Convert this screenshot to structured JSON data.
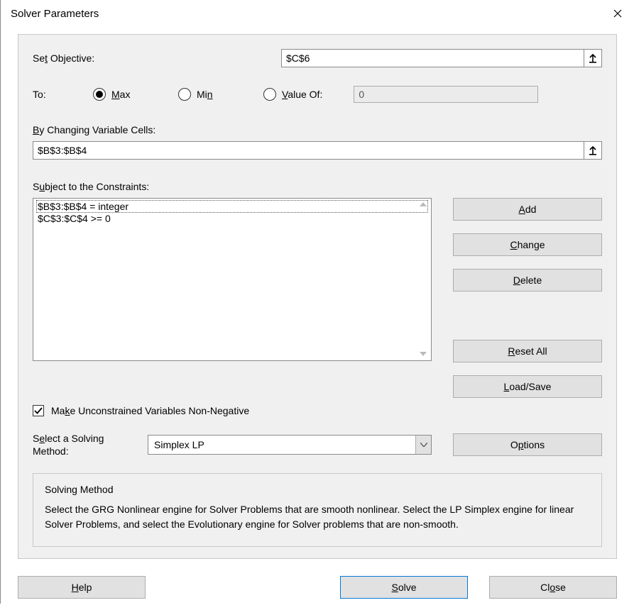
{
  "window": {
    "title": "Solver Parameters"
  },
  "objective": {
    "label_pre": "Se",
    "label_u": "t",
    "label_post": " Objective:",
    "value": "$C$6"
  },
  "to": {
    "label": "To:",
    "max_u": "M",
    "max_post": "ax",
    "min_u": "n",
    "min_pre": "Mi",
    "valof_u": "V",
    "valof_post": "alue Of:",
    "selected": "max",
    "value_of_value": "0"
  },
  "changing": {
    "label_u": "B",
    "label_post": "y Changing Variable Cells:",
    "value": "$B$3:$B$4"
  },
  "constraints": {
    "label_pre": "S",
    "label_u": "u",
    "label_post": "bject to the Constraints:",
    "items": [
      "$B$3:$B$4 = integer",
      "$C$3:$C$4 >= 0"
    ],
    "selected_index": 0
  },
  "buttons": {
    "add_u": "A",
    "add_post": "dd",
    "change_u": "C",
    "change_post": "hange",
    "delete_u": "D",
    "delete_post": "elete",
    "reset_u": "R",
    "reset_post": "eset All",
    "load_u": "L",
    "load_post": "oad/Save",
    "options_pre": "O",
    "options_u": "p",
    "options_post": "tions",
    "help_u": "H",
    "help_post": "elp",
    "solve_u": "S",
    "solve_post": "olve",
    "close_pre": "Cl",
    "close_u": "o",
    "close_post": "se"
  },
  "nonneg": {
    "label_pre": "Ma",
    "label_u": "k",
    "label_post": "e Unconstrained Variables Non-Negative",
    "checked": true
  },
  "method": {
    "label_pre": "S",
    "label_u": "e",
    "label_post": "lect a Solving Method:",
    "value": "Simplex LP"
  },
  "desc": {
    "heading": "Solving Method",
    "text": "Select the GRG Nonlinear engine for Solver Problems that are smooth nonlinear. Select the LP Simplex engine for linear Solver Problems, and select the Evolutionary engine for Solver problems that are non-smooth."
  }
}
